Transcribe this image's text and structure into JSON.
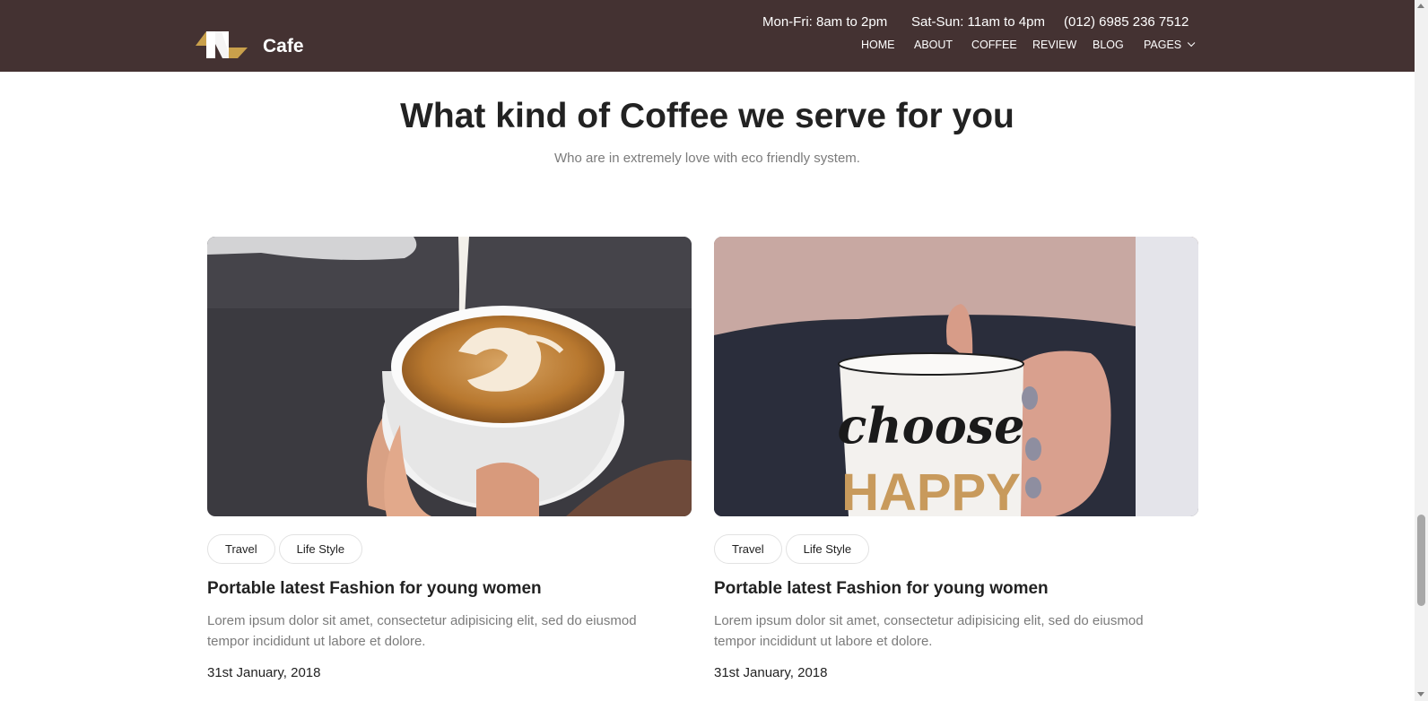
{
  "header": {
    "brand": "Cafe",
    "hours_weekday": "Mon-Fri: 8am to 2pm",
    "hours_weekend": "Sat-Sun: 11am to 4pm",
    "phone": "(012) 6985 236 7512",
    "nav": [
      "HOME",
      "ABOUT",
      "COFFEE",
      "REVIEW",
      "BLOG",
      "PAGES"
    ]
  },
  "section": {
    "title": "What kind of Coffee we serve for you",
    "subtitle": "Who are in extremely love with eco friendly system."
  },
  "cards": [
    {
      "image_icon": "latte-art-photo",
      "tags": [
        "Travel",
        "Life Style"
      ],
      "title": "Portable latest Fashion for young women",
      "text": "Lorem ipsum dolor sit amet, consectetur adipisicing elit, sed do eiusmod tempor incididunt ut labore et dolore.",
      "date": "31st January, 2018"
    },
    {
      "image_icon": "choose-happy-mug-photo",
      "mug_text_1": "choose",
      "mug_text_2": "HAPPY",
      "tags": [
        "Travel",
        "Life Style"
      ],
      "title": "Portable latest Fashion for young women",
      "text": "Lorem ipsum dolor sit amet, consectetur adipisicing elit, sed do eiusmod tempor incididunt ut labore et dolore.",
      "date": "31st January, 2018"
    }
  ],
  "colors": {
    "header_bg": "#443232",
    "logo_gold": "#c9a04b",
    "text_dark": "#222222",
    "text_muted": "#7b7b7b"
  }
}
